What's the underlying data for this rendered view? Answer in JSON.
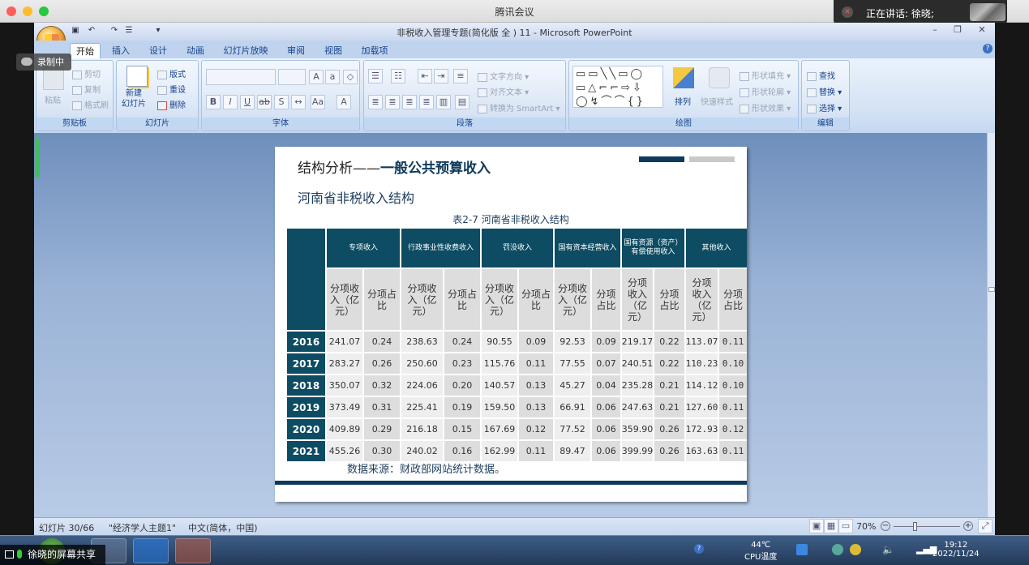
{
  "mac": {
    "title": "腾讯会议",
    "speaker": "正在讲话: 徐晓;",
    "recording": "录制中",
    "share_label": "徐晓的屏幕共享"
  },
  "ppt": {
    "title": "非税收入管理专题(简化版 全 ) 11 - Microsoft PowerPoint",
    "tabs": [
      "开始",
      "插入",
      "设计",
      "动画",
      "幻灯片放映",
      "审阅",
      "视图",
      "加载项"
    ],
    "groups": {
      "clipboard": {
        "label": "剪贴板",
        "paste": "粘贴",
        "cut": "剪切",
        "copy": "复制",
        "format": "格式刷"
      },
      "slides": {
        "label": "幻灯片",
        "new": "新建\n幻灯片",
        "layout": "版式",
        "reset": "重设",
        "delete": "删除"
      },
      "font": {
        "label": "字体"
      },
      "paragraph": {
        "label": "段落",
        "direction": "文字方向",
        "align": "对齐文本",
        "smartart": "转换为 SmartArt"
      },
      "drawing": {
        "label": "绘图",
        "arrange": "排列",
        "quick": "快速样式",
        "fill": "形状填充",
        "outline": "形状轮廓",
        "effect": "形状效果"
      },
      "edit": {
        "label": "编辑",
        "find": "查找",
        "replace": "替换",
        "select": "选择"
      }
    },
    "status": {
      "slide": "幻灯片 30/66",
      "theme": "\"经济学人主题1\"",
      "lang": "中文(简体，中国)",
      "zoom": "70%"
    }
  },
  "slide": {
    "heading_a": "结构分析——",
    "heading_b": "一般公共预算收入",
    "subtitle": "河南省非税收入结构",
    "table_caption": "表2-7  河南省非税收入结构",
    "source": "数据来源：财政部网站统计数据。",
    "groups": [
      "专项收入",
      "行政事业性收费收入",
      "罚没收入",
      "国有资本经营收入",
      "国有资源（资产）有偿使用收入",
      "其他收入"
    ],
    "subheads": [
      "分项收入（亿元）",
      "分项占比",
      "分项收入（亿元）",
      "分项占比",
      "分项收入（亿元）",
      "分项占比",
      "分项收入（亿元）",
      "分项占比",
      "分项收入（亿元）",
      "分项占比",
      "分项收入（亿元）",
      "分项占比"
    ],
    "rows": [
      {
        "year": "2016",
        "cells": [
          "241.07",
          "0.24",
          "238.63",
          "0.24",
          "90.55",
          "0.09",
          "92.53",
          "0.09",
          "219.17",
          "0.22",
          "113.07",
          "0.11"
        ]
      },
      {
        "year": "2017",
        "cells": [
          "283.27",
          "0.26",
          "250.60",
          "0.23",
          "115.76",
          "0.11",
          "77.55",
          "0.07",
          "240.51",
          "0.22",
          "110.23",
          "0.10"
        ]
      },
      {
        "year": "2018",
        "cells": [
          "350.07",
          "0.32",
          "224.06",
          "0.20",
          "140.57",
          "0.13",
          "45.27",
          "0.04",
          "235.28",
          "0.21",
          "114.12",
          "0.10"
        ]
      },
      {
        "year": "2019",
        "cells": [
          "373.49",
          "0.31",
          "225.41",
          "0.19",
          "159.50",
          "0.13",
          "66.91",
          "0.06",
          "247.63",
          "0.21",
          "127.60",
          "0.11"
        ]
      },
      {
        "year": "2020",
        "cells": [
          "409.89",
          "0.29",
          "216.18",
          "0.15",
          "167.69",
          "0.12",
          "77.52",
          "0.06",
          "359.90",
          "0.26",
          "172.93",
          "0.12"
        ]
      },
      {
        "year": "2021",
        "cells": [
          "455.26",
          "0.30",
          "240.02",
          "0.16",
          "162.99",
          "0.11",
          "89.47",
          "0.06",
          "399.99",
          "0.26",
          "163.63",
          "0.11"
        ]
      }
    ]
  },
  "taskbar": {
    "temp": "44℃",
    "cpu": "CPU温度",
    "time": "19:12",
    "date": "2022/11/24"
  }
}
